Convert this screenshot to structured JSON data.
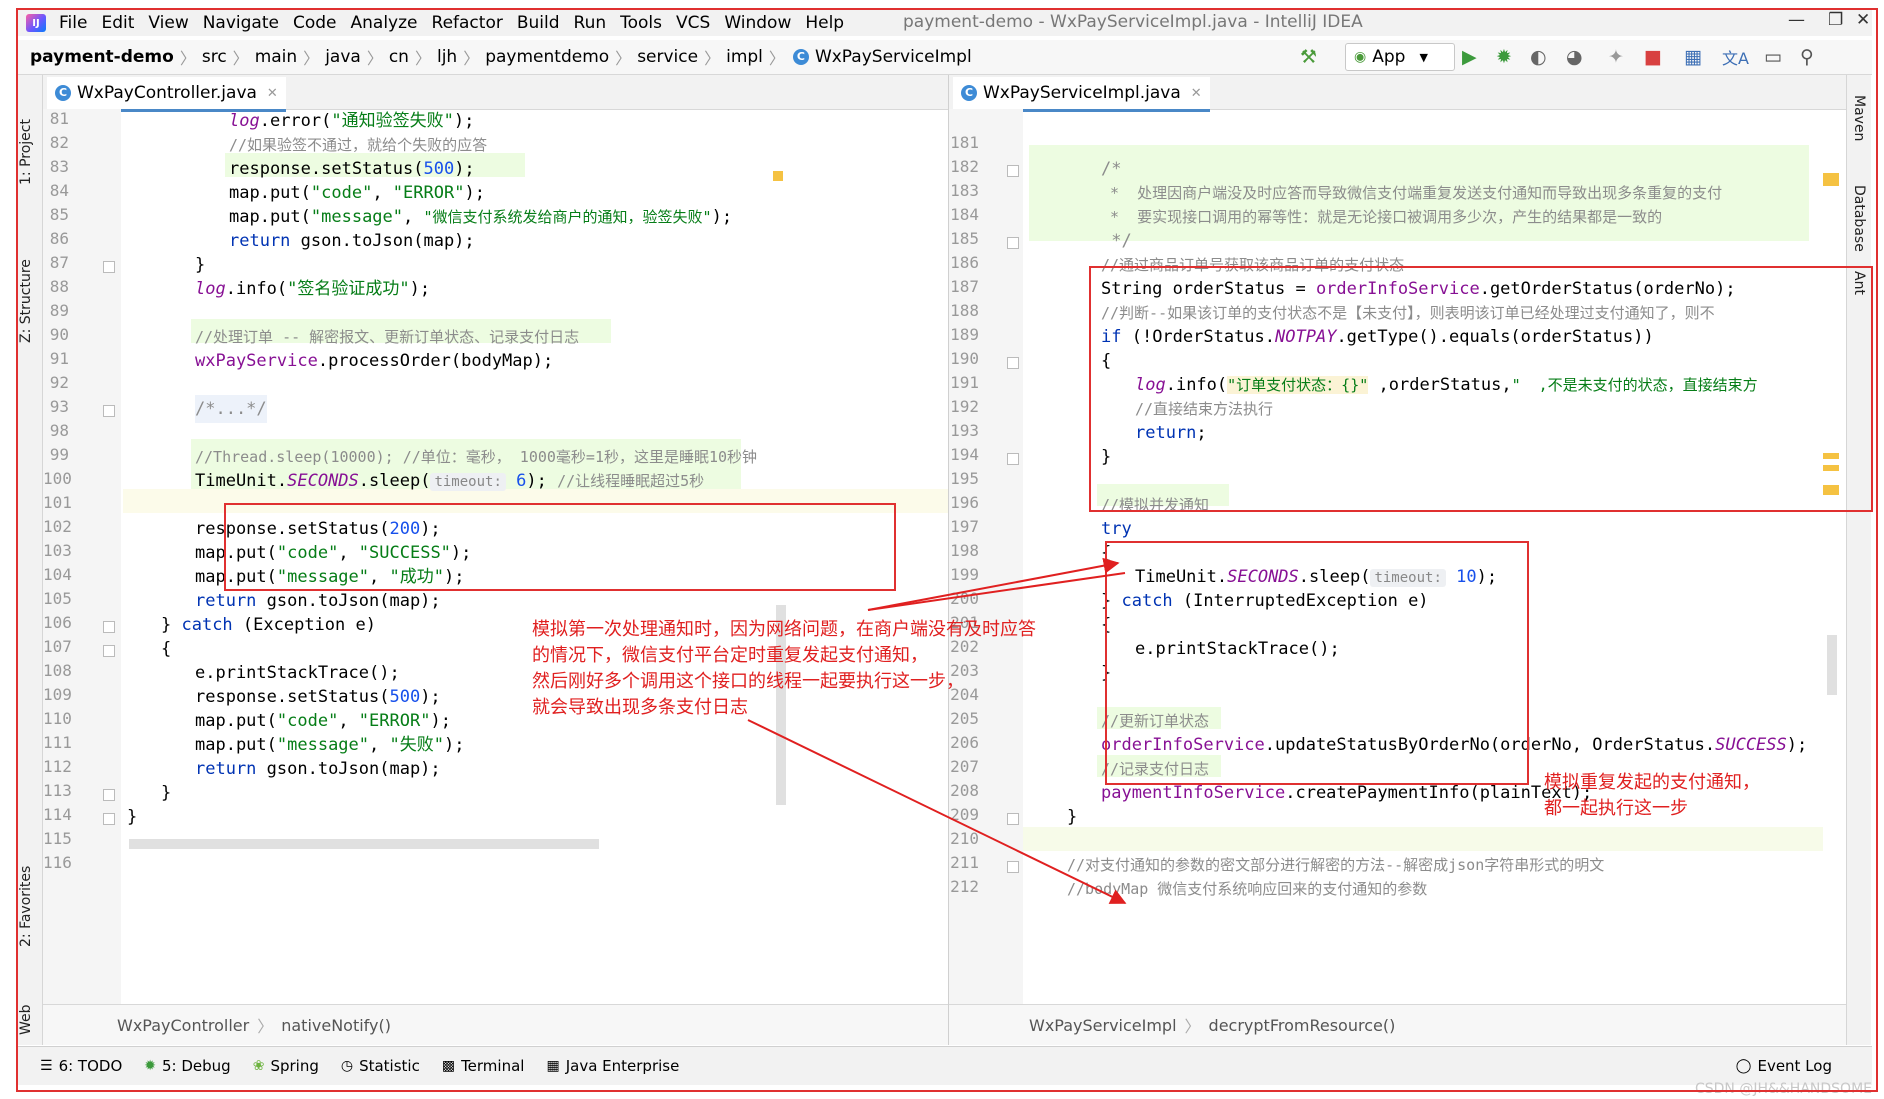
{
  "window": {
    "title": "payment-demo - WxPayServiceImpl.java - IntelliJ IDEA",
    "menu": [
      "File",
      "Edit",
      "View",
      "Navigate",
      "Code",
      "Analyze",
      "Refactor",
      "Build",
      "Run",
      "Tools",
      "VCS",
      "Window",
      "Help"
    ]
  },
  "navbar": {
    "breadcrumbs": [
      "payment-demo",
      "src",
      "main",
      "java",
      "cn",
      "ljh",
      "paymentdemo",
      "service",
      "impl",
      "WxPayServiceImpl"
    ],
    "run_config": "App"
  },
  "left_tools": [
    "1: Project",
    "Z: Structure",
    "2: Favorites",
    "Web"
  ],
  "right_tools": [
    "Maven",
    "Database",
    "Ant"
  ],
  "left_editor": {
    "tab": "WxPayController.java",
    "breadcrumb": [
      "WxPayController",
      "nativeNotify()"
    ],
    "line_numbers": [
      "81",
      "82",
      "83",
      "84",
      "85",
      "86",
      "87",
      "88",
      "89",
      "90",
      "91",
      "92",
      "93",
      "98",
      "99",
      "100",
      "101",
      "102",
      "103",
      "104",
      "105",
      "106",
      "107",
      "108",
      "109",
      "110",
      "111",
      "112",
      "113",
      "114",
      "115",
      "116"
    ],
    "code": {
      "l81_a": "log",
      "l81_b": ".error(",
      "l81_c": "\"通知验签失败\"",
      "l81_d": ");",
      "l82": "//如果验签不通过，就给个失败的应答",
      "l83_a": "response.setStatus(",
      "l83_b": "500",
      "l83_c": ");",
      "l84_a": "map.put(",
      "l84_b": "\"code\"",
      "l84_c": ", ",
      "l84_d": "\"ERROR\"",
      "l84_e": ");",
      "l85_a": "map.put(",
      "l85_b": "\"message\"",
      "l85_c": ", ",
      "l85_d": "\"微信支付系统发给商户的通知，验签失败\"",
      "l85_e": ");",
      "l86_a": "return",
      "l86_b": " gson.toJson(map);",
      "l87": "}",
      "l88_a": "log",
      "l88_b": ".info(",
      "l88_c": "\"签名验证成功\"",
      "l88_d": ");",
      "l90": "//处理订单 -- 解密报文、更新订单状态、记录支付日志",
      "l91_a": "wxPayService",
      "l91_b": ".processOrder(bodyMap);",
      "l93": "/*...*/",
      "l99": "//Thread.sleep(10000); //单位：毫秒， 1000毫秒=1秒，这里是睡眠10秒钟",
      "l100_a": "TimeUnit.",
      "l100_b": "SECONDS",
      "l100_c": ".sleep(",
      "l100_hint": "timeout:",
      "l100_d": " 6",
      "l100_e": "); ",
      "l100_f": "//让线程睡眠超过5秒",
      "l102_a": "response.setStatus(",
      "l102_b": "200",
      "l102_c": ");",
      "l103_a": "map.put(",
      "l103_b": "\"code\"",
      "l103_c": ", ",
      "l103_d": "\"SUCCESS\"",
      "l103_e": ");",
      "l104_a": "map.put(",
      "l104_b": "\"message\"",
      "l104_c": ", ",
      "l104_d": "\"成功\"",
      "l104_e": ");",
      "l105_a": "return",
      "l105_b": " gson.toJson(map);",
      "l106_a": "} ",
      "l106_b": "catch",
      "l106_c": " (Exception e)",
      "l107": "{",
      "l108": "e.printStackTrace();",
      "l109_a": "response.setStatus(",
      "l109_b": "500",
      "l109_c": ");",
      "l110_a": "map.put(",
      "l110_b": "\"code\"",
      "l110_c": ", ",
      "l110_d": "\"ERROR\"",
      "l110_e": ");",
      "l111_a": "map.put(",
      "l111_b": "\"message\"",
      "l111_c": ", ",
      "l111_d": "\"失败\"",
      "l111_e": ");",
      "l112_a": "return",
      "l112_b": " gson.toJson(map);",
      "l113": "}",
      "l114": "}"
    }
  },
  "right_editor": {
    "tab": "WxPayServiceImpl.java",
    "breadcrumb": [
      "WxPayServiceImpl",
      "decryptFromResource()"
    ],
    "line_numbers": [
      "181",
      "182",
      "183",
      "184",
      "185",
      "186",
      "187",
      "188",
      "189",
      "190",
      "191",
      "192",
      "193",
      "194",
      "195",
      "196",
      "197",
      "198",
      "199",
      "200",
      "201",
      "202",
      "203",
      "204",
      "205",
      "206",
      "207",
      "208",
      "209",
      "210",
      "211",
      "212"
    ],
    "code": {
      "l182": "/*",
      "l183": " *  处理因商户端没及时应答而导致微信支付端重复发送支付通知而导致出现多条重复的支付",
      "l184": " *  要实现接口调用的幂等性：就是无论接口被调用多少次，产生的结果都是一致的",
      "l185": " */",
      "l186": "//通过商品订单号获取该商品订单的支付状态",
      "l187_a": "String orderStatus = ",
      "l187_b": "orderInfoService",
      "l187_c": ".getOrderStatus(orderNo);",
      "l188": "//判断--如果该订单的支付状态不是【未支付】，则表明该订单已经处理过支付通知了，则不",
      "l189_a": "if",
      "l189_b": " (!OrderStatus.",
      "l189_c": "NOTPAY",
      "l189_d": ".getType().equals(orderStatus))",
      "l190": "{",
      "l191_a": "log",
      "l191_b": ".info(",
      "l191_c": "\"订单支付状态：{}\"",
      "l191_d": " ,orderStatus,",
      "l191_e": "\"  ,不是未支付的状态，直接结束方",
      "l192": "//直接结束方法执行",
      "l193_a": "return",
      "l193_b": ";",
      "l194": "}",
      "l196": "//模拟并发通知",
      "l197": "try",
      "l198": "{",
      "l199_a": "TimeUnit.",
      "l199_b": "SECONDS",
      "l199_c": ".sleep(",
      "l199_hint": "timeout:",
      "l199_d": " 10",
      "l199_e": ");",
      "l200_a": "} ",
      "l200_b": "catch",
      "l200_c": " (InterruptedException e)",
      "l201": "{",
      "l202": "e.printStackTrace();",
      "l203": "}",
      "l205": "//更新订单状态",
      "l206_a": "orderInfoService",
      "l206_b": ".updateStatusByOrderNo(orderNo, OrderStatus.",
      "l206_c": "SUCCESS",
      "l206_d": ");",
      "l207": "//记录支付日志",
      "l208_a": "paymentInfoService",
      "l208_b": ".createPaymentInfo(plainText);",
      "l209": "}",
      "l211": "//对支付通知的参数的密文部分进行解密的方法--解密成json字符串形式的明文",
      "l212": "//bodyMap 微信支付系统响应回来的支付通知的参数"
    }
  },
  "annotations": {
    "left_note": [
      "模拟第一次处理通知时，因为网络问题，在商户端没有及时应答",
      "的情况下，微信支付平台定时重复发起支付通知，",
      "然后刚好多个调用这个接口的线程一起要执行这一步，",
      "就会导致出现多条支付日志"
    ],
    "right_note": [
      "模拟重复发起的支付通知，",
      "都一起执行这一步"
    ]
  },
  "bottom_tools": [
    {
      "icon": "todo-icon",
      "label": "6: TODO"
    },
    {
      "icon": "debug-icon",
      "label": "5: Debug"
    },
    {
      "icon": "spring-icon",
      "label": "Spring"
    },
    {
      "icon": "statistic-icon",
      "label": "Statistic"
    },
    {
      "icon": "terminal-icon",
      "label": "Terminal"
    },
    {
      "icon": "enterprise-icon",
      "label": "Java Enterprise"
    }
  ],
  "event_log": "Event Log",
  "watermark": "CSDN @JH&&HANDSOME",
  "colors": {
    "annotation": "#e02020",
    "keyword": "#0033b3",
    "string": "#067d17",
    "comment": "#8c8c8c",
    "field": "#871094"
  }
}
